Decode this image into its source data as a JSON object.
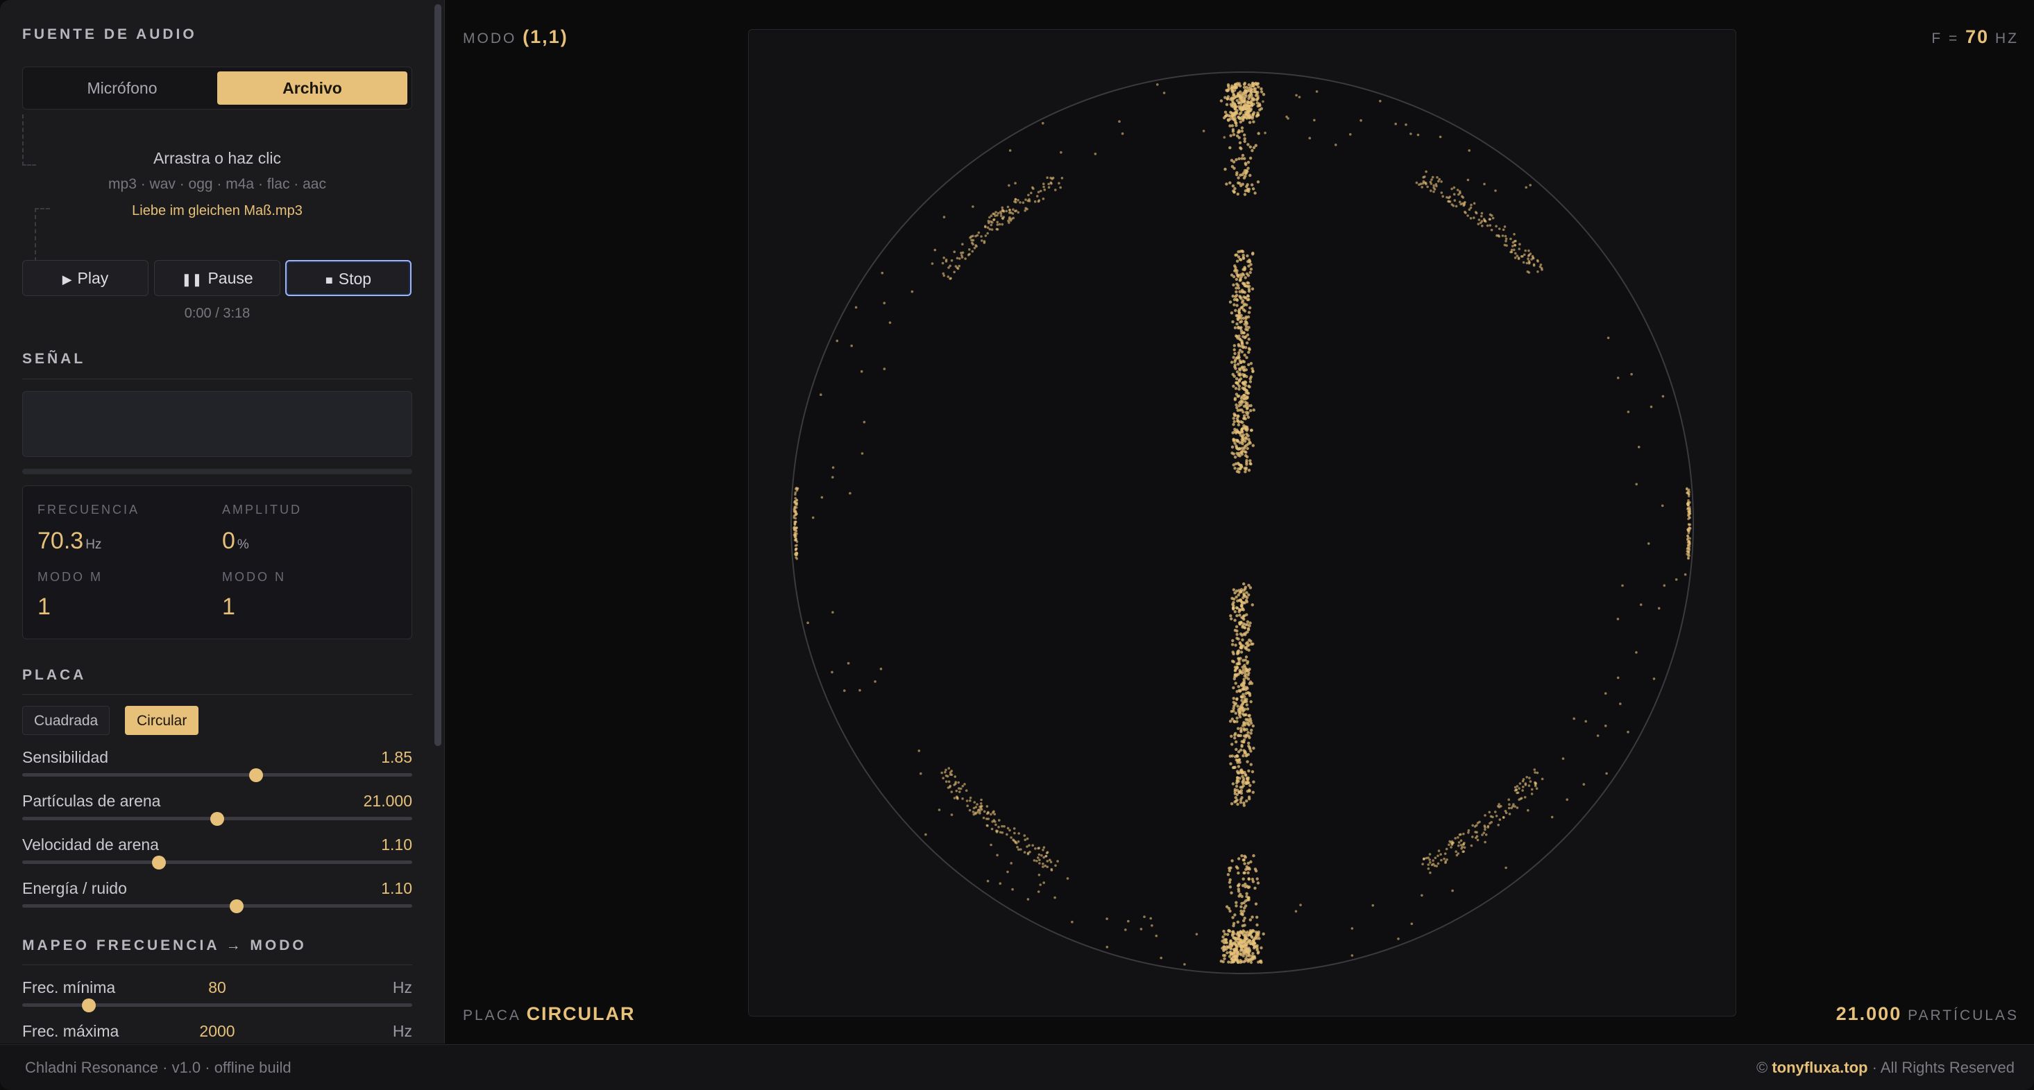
{
  "sidebar": {
    "audio_source": {
      "title": "FUENTE DE AUDIO",
      "tabs": [
        {
          "label": "Micrófono"
        },
        {
          "label": "Archivo",
          "active": true
        }
      ],
      "drop_zone": {
        "prompt": "Arrastra o haz clic",
        "formats": "mp3 · wav · ogg · m4a · flac · aac",
        "file_name": "Liebe im gleichen Maß.mp3"
      },
      "transport": {
        "play": "Play",
        "pause": "Pause",
        "stop": "Stop"
      },
      "time": "0:00 / 3:18"
    },
    "signal": {
      "title": "SEÑAL",
      "stats": {
        "frequency": {
          "label": "FRECUENCIA",
          "value": "70.3",
          "unit": "Hz"
        },
        "amplitude": {
          "label": "AMPLITUD",
          "value": "0",
          "unit": "%"
        },
        "mode_m": {
          "label": "MODO M",
          "value": "1"
        },
        "mode_n": {
          "label": "MODO N",
          "value": "1"
        }
      }
    },
    "plate": {
      "title": "PLACA",
      "options": [
        {
          "label": "Cuadrada"
        },
        {
          "label": "Circular",
          "active": true
        }
      ],
      "sliders": [
        {
          "label": "Sensibilidad",
          "value": "1.85",
          "fraction": 0.6
        },
        {
          "label": "Partículas de arena",
          "value": "21.000",
          "fraction": 0.5
        },
        {
          "label": "Velocidad de arena",
          "value": "1.10",
          "fraction": 0.35
        },
        {
          "label": "Energía / ruido",
          "value": "1.10",
          "fraction": 0.55
        }
      ]
    },
    "mapping": {
      "title": "MAPEO FRECUENCIA → MODO",
      "min": {
        "label": "Frec. mínima",
        "value": "80",
        "unit": "Hz",
        "fraction": 0.17
      },
      "max": {
        "label": "Frec. máxima",
        "value": "2000",
        "unit": "Hz"
      }
    }
  },
  "stage": {
    "mode_label": "MODO",
    "mode_value": "(1,1)",
    "freq_label": "F =",
    "freq_value": "70",
    "freq_unit": "HZ",
    "plate_label": "PLACA",
    "plate_value": "CIRCULAR",
    "particles_value": "21.000",
    "particles_label": "PARTÍCULAS"
  },
  "footer": {
    "left": "Chladni Resonance · v1.0 · offline build",
    "right_prefix": "©",
    "right_brand": "tonyfluxa.top",
    "right_suffix": "· All Rights Reserved"
  },
  "colors": {
    "accent": "#e7c17a",
    "focus": "#9db5ff",
    "background": "#0b0b0c"
  }
}
